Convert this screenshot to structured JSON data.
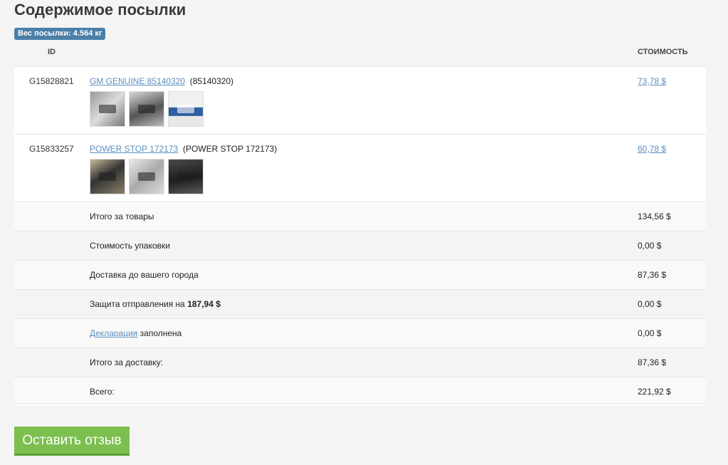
{
  "header": {
    "title": "Содержимое посылки",
    "weight_badge": "Вес посылки: 4.564 кг"
  },
  "table": {
    "columns": {
      "id": "ID",
      "cost": "СТОИМОСТЬ"
    },
    "items": [
      {
        "id": "G15828821",
        "link_text": "GM GENUINE 85140320",
        "extra": "(85140320)",
        "price": "73,78 $",
        "thumbnails": [
          "product-photo-1",
          "product-photo-2",
          "product-photo-3"
        ]
      },
      {
        "id": "G15833257",
        "link_text": "POWER STOP 172173",
        "extra": "(POWER STOP 172173)",
        "price": "60,78 $",
        "thumbnails": [
          "product-photo-1",
          "product-photo-2",
          "product-photo-3"
        ]
      }
    ],
    "summary": {
      "goods_total": {
        "label": "Итого за товары",
        "value": "134,56 $"
      },
      "packaging": {
        "label": "Стоимость упаковки",
        "value": "0,00 $"
      },
      "delivery": {
        "label": "Доставка до вашего города",
        "value": "87,36 $"
      },
      "protection": {
        "label": "Защита отправления на",
        "amount": "187,94 $",
        "value": "0,00 $"
      },
      "declaration": {
        "link": "Декларация",
        "label": "заполнена",
        "value": "0,00 $"
      },
      "shipping_total": {
        "label": "Итого за доставку:",
        "value": "87,36 $"
      },
      "grand_total": {
        "label": "Всего:",
        "value": "221,92 $"
      }
    }
  },
  "actions": {
    "review_button": "Оставить отзыв"
  },
  "colors": {
    "badge": "#4a7fa8",
    "link": "#5b8fbf",
    "button": "#7cbf4f"
  }
}
